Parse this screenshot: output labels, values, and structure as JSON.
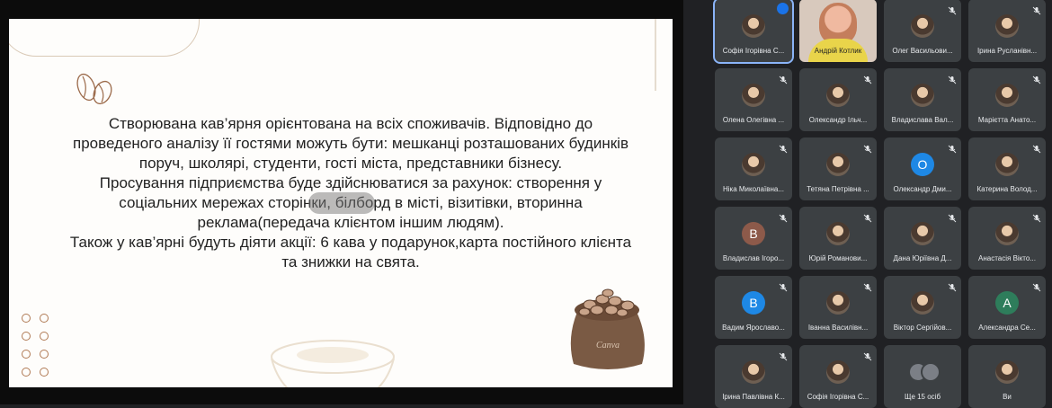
{
  "slide": {
    "text_lines": [
      "Створювана кав’ярня орієнтована на всіх споживачів. Відповідно до",
      "проведеного аналізу її гостями можуть бути: мешканці розташованих будинків",
      "поруч, школярі, студенти, гості міста, представники бізнесу.",
      "Просування підприємства буде здійснюватися за рахунок: створення у",
      "соціальних мережах сторінки, білборд в місті, візитівки, вторинна",
      "реклама(передача клієнтом іншим людям).",
      "Також у кав’ярні будуть діяти акції: 6 кава у подарунок,карта постійного клієнта",
      "та знижки на свята."
    ],
    "sack_label": "Canva"
  },
  "participants": [
    {
      "name": "Софія Ігорівна С...",
      "avatar": "photo",
      "status": "speaking"
    },
    {
      "name": "Андрій Котлик",
      "avatar": "video",
      "status": "video"
    },
    {
      "name": "Олег Васильови...",
      "avatar": "photo",
      "status": "muted"
    },
    {
      "name": "Ірина Русланівн...",
      "avatar": "photo",
      "status": "muted"
    },
    {
      "name": "Олена Олегівна ...",
      "avatar": "photo",
      "status": "muted"
    },
    {
      "name": "Олександр Ільч...",
      "avatar": "photo",
      "status": "muted"
    },
    {
      "name": "Владислава Вал...",
      "avatar": "photo",
      "status": "muted"
    },
    {
      "name": "Марієтта Анато...",
      "avatar": "photo",
      "status": "muted"
    },
    {
      "name": "Ніка Миколаївна...",
      "avatar": "photo",
      "status": "muted"
    },
    {
      "name": "Тетяна Петрівна ...",
      "avatar": "photo",
      "status": "muted"
    },
    {
      "name": "Олександр Дми...",
      "avatar": "letter",
      "letter": "О",
      "color": "#1e88e5",
      "status": "muted"
    },
    {
      "name": "Катерина Волод...",
      "avatar": "photo",
      "status": "muted"
    },
    {
      "name": "Владислав Ігоро...",
      "avatar": "letter",
      "letter": "В",
      "color": "#8d5a4a",
      "status": "muted"
    },
    {
      "name": "Юрій Романови...",
      "avatar": "photo",
      "status": "muted"
    },
    {
      "name": "Дана Юріївна Д...",
      "avatar": "photo",
      "status": "muted"
    },
    {
      "name": "Анастасія Вікто...",
      "avatar": "photo",
      "status": "muted"
    },
    {
      "name": "Вадим Ярославо...",
      "avatar": "letter",
      "letter": "В",
      "color": "#1e88e5",
      "status": "muted"
    },
    {
      "name": "Іванна Василівн...",
      "avatar": "photo",
      "status": "muted"
    },
    {
      "name": "Віктор Сергійов...",
      "avatar": "photo",
      "status": "muted"
    },
    {
      "name": "Александра Се...",
      "avatar": "letter",
      "letter": "А",
      "color": "#2e7d5b",
      "status": "muted"
    },
    {
      "name": "Ірина Павлівна К...",
      "avatar": "photo",
      "status": "muted"
    },
    {
      "name": "Софія Ігорівна С...",
      "avatar": "photo",
      "status": "muted"
    },
    {
      "name": "Ще 15 осіб",
      "avatar": "stack",
      "status": "more"
    },
    {
      "name": "Ви",
      "avatar": "photo",
      "status": "self"
    }
  ]
}
